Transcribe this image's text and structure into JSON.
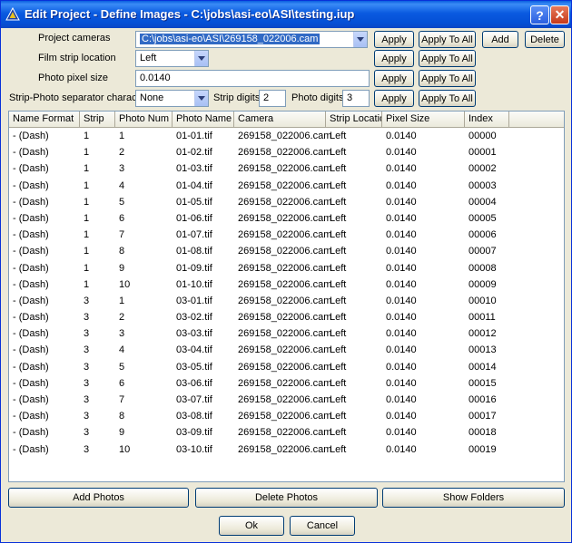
{
  "window": {
    "title": "Edit Project - Define Images - C:\\jobs\\asi-eo\\ASI\\testing.iup",
    "help_label": "?",
    "close_label": "✕"
  },
  "settings": {
    "cameras_label": "Project cameras",
    "cameras_value": "C:\\jobs\\asi-eo\\ASI\\269158_022006.cam",
    "film_strip_label": "Film strip location",
    "film_strip_value": "Left",
    "pixel_size_label": "Photo pixel size",
    "pixel_size_value": "0.0140",
    "separator_label": "Strip-Photo separator character",
    "separator_value": "None",
    "strip_digits_label": "Strip digits",
    "strip_digits_value": "2",
    "photo_digits_label": "Photo digits",
    "photo_digits_value": "3",
    "apply_label": "Apply",
    "apply_all_label": "Apply To All",
    "add_label": "Add",
    "delete_label": "Delete"
  },
  "table": {
    "columns": [
      "Name Format",
      "Strip",
      "Photo Num",
      "Photo Name",
      "Camera",
      "Strip Location",
      "Pixel Size",
      "Index"
    ],
    "rows": [
      [
        "- (Dash)",
        "1",
        "1",
        "01-01.tif",
        "269158_022006.cam",
        "Left",
        "0.0140",
        "00000"
      ],
      [
        "- (Dash)",
        "1",
        "2",
        "01-02.tif",
        "269158_022006.cam",
        "Left",
        "0.0140",
        "00001"
      ],
      [
        "- (Dash)",
        "1",
        "3",
        "01-03.tif",
        "269158_022006.cam",
        "Left",
        "0.0140",
        "00002"
      ],
      [
        "- (Dash)",
        "1",
        "4",
        "01-04.tif",
        "269158_022006.cam",
        "Left",
        "0.0140",
        "00003"
      ],
      [
        "- (Dash)",
        "1",
        "5",
        "01-05.tif",
        "269158_022006.cam",
        "Left",
        "0.0140",
        "00004"
      ],
      [
        "- (Dash)",
        "1",
        "6",
        "01-06.tif",
        "269158_022006.cam",
        "Left",
        "0.0140",
        "00005"
      ],
      [
        "- (Dash)",
        "1",
        "7",
        "01-07.tif",
        "269158_022006.cam",
        "Left",
        "0.0140",
        "00006"
      ],
      [
        "- (Dash)",
        "1",
        "8",
        "01-08.tif",
        "269158_022006.cam",
        "Left",
        "0.0140",
        "00007"
      ],
      [
        "- (Dash)",
        "1",
        "9",
        "01-09.tif",
        "269158_022006.cam",
        "Left",
        "0.0140",
        "00008"
      ],
      [
        "- (Dash)",
        "1",
        "10",
        "01-10.tif",
        "269158_022006.cam",
        "Left",
        "0.0140",
        "00009"
      ],
      [
        "- (Dash)",
        "3",
        "1",
        "03-01.tif",
        "269158_022006.cam",
        "Left",
        "0.0140",
        "00010"
      ],
      [
        "- (Dash)",
        "3",
        "2",
        "03-02.tif",
        "269158_022006.cam",
        "Left",
        "0.0140",
        "00011"
      ],
      [
        "- (Dash)",
        "3",
        "3",
        "03-03.tif",
        "269158_022006.cam",
        "Left",
        "0.0140",
        "00012"
      ],
      [
        "- (Dash)",
        "3",
        "4",
        "03-04.tif",
        "269158_022006.cam",
        "Left",
        "0.0140",
        "00013"
      ],
      [
        "- (Dash)",
        "3",
        "5",
        "03-05.tif",
        "269158_022006.cam",
        "Left",
        "0.0140",
        "00014"
      ],
      [
        "- (Dash)",
        "3",
        "6",
        "03-06.tif",
        "269158_022006.cam",
        "Left",
        "0.0140",
        "00015"
      ],
      [
        "- (Dash)",
        "3",
        "7",
        "03-07.tif",
        "269158_022006.cam",
        "Left",
        "0.0140",
        "00016"
      ],
      [
        "- (Dash)",
        "3",
        "8",
        "03-08.tif",
        "269158_022006.cam",
        "Left",
        "0.0140",
        "00017"
      ],
      [
        "- (Dash)",
        "3",
        "9",
        "03-09.tif",
        "269158_022006.cam",
        "Left",
        "0.0140",
        "00018"
      ],
      [
        "- (Dash)",
        "3",
        "10",
        "03-10.tif",
        "269158_022006.cam",
        "Left",
        "0.0140",
        "00019"
      ]
    ]
  },
  "actions": {
    "add_photos": "Add Photos",
    "delete_photos": "Delete Photos",
    "show_folders": "Show Folders",
    "ok": "Ok",
    "cancel": "Cancel"
  },
  "colors": {
    "titlebar": "#0a5ae0",
    "dialog_bg": "#ece9d8",
    "selection": "#316ac5"
  }
}
